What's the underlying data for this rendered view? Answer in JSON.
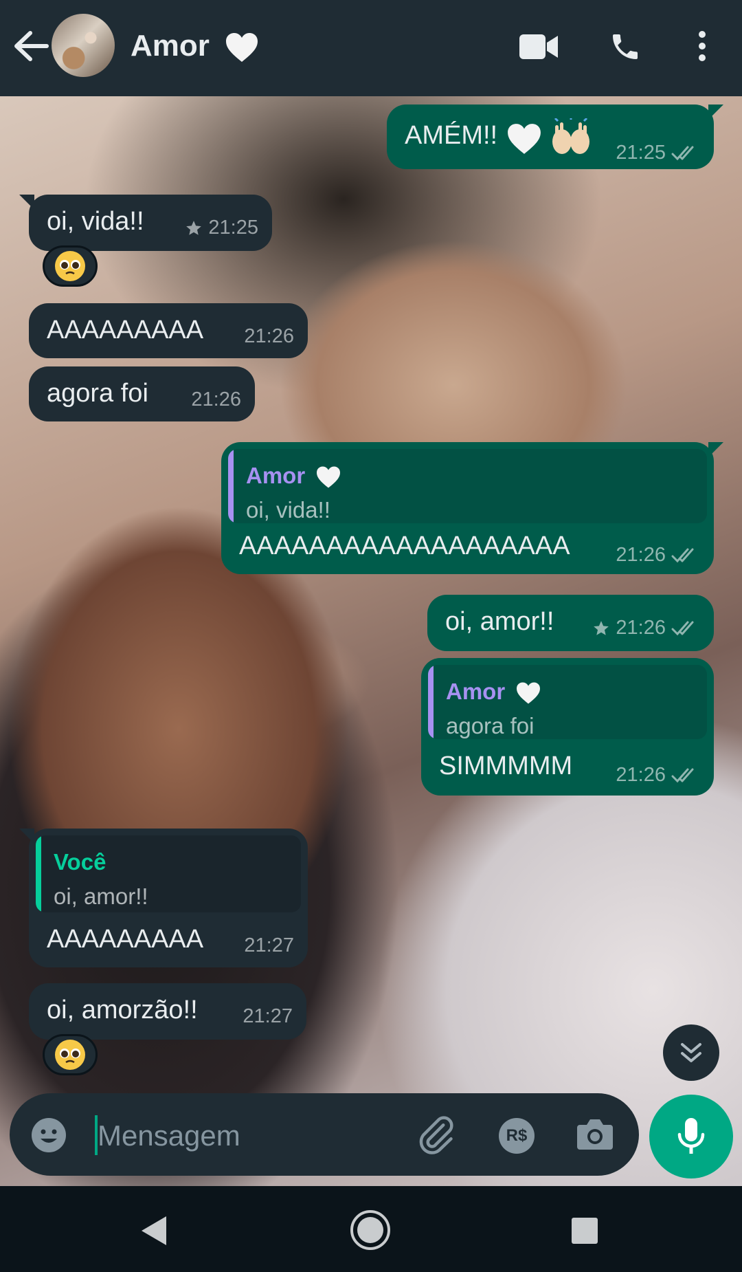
{
  "header": {
    "contact_name": "Amor",
    "icons": [
      "back-arrow-icon",
      "video-call-icon",
      "voice-call-icon",
      "more-vert-icon"
    ]
  },
  "messages": [
    {
      "direction": "out",
      "text": "AMÉM!!",
      "emoji": [
        "white-heart",
        "raising-hands"
      ],
      "time": "21:25",
      "status": "read"
    },
    {
      "direction": "in",
      "text": "oi, vida!!",
      "time": "21:25",
      "starred": true,
      "reaction": "pleading-face"
    },
    {
      "direction": "in",
      "text": "AAAAAAAAA",
      "time": "21:26"
    },
    {
      "direction": "in",
      "text": "agora foi",
      "time": "21:26"
    },
    {
      "direction": "out",
      "quote": {
        "author": "Amor",
        "text": "oi, vida!!"
      },
      "text": "AAAAAAAAAAAAAAAAAAA",
      "time": "21:26",
      "status": "read"
    },
    {
      "direction": "out",
      "text": "oi, amor!!",
      "time": "21:26",
      "starred": true,
      "status": "read"
    },
    {
      "direction": "out",
      "quote": {
        "author": "Amor",
        "text": "agora foi"
      },
      "text": "SIMMMMM",
      "time": "21:26",
      "status": "read"
    },
    {
      "direction": "in",
      "quote": {
        "author": "Você",
        "text": "oi, amor!!"
      },
      "text": "AAAAAAAAA",
      "time": "21:27"
    },
    {
      "direction": "in",
      "text": "oi, amorzão!!",
      "time": "21:27",
      "reaction": "pleading-face"
    }
  ],
  "composer": {
    "placeholder": "Mensagem",
    "icons": [
      "emoji-icon",
      "attach-icon",
      "payment-icon",
      "camera-icon",
      "mic-icon"
    ]
  },
  "colors": {
    "header_bg": "#1f2c34",
    "incoming_bubble": "#1f2c34",
    "outgoing_bubble": "#005c4b",
    "accent": "#00a884",
    "quote_author_purple": "#a791f1",
    "quote_author_green": "#06cf9c"
  }
}
